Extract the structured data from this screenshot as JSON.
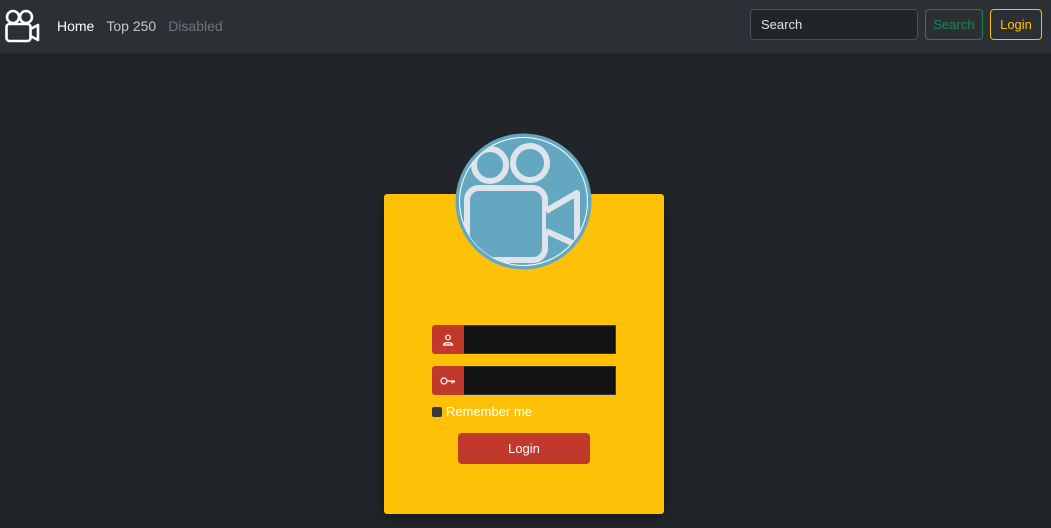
{
  "navbar": {
    "brand_icon": "video-camera-icon",
    "links": [
      {
        "label": "Home",
        "state": "active"
      },
      {
        "label": "Top 250",
        "state": "normal"
      },
      {
        "label": "Disabled",
        "state": "disabled"
      }
    ],
    "search": {
      "placeholder": "Search",
      "button_label": "Search"
    },
    "login_label": "Login"
  },
  "login_form": {
    "avatar_icon": "video-camera-icon",
    "username": {
      "icon": "user-icon",
      "value": ""
    },
    "password": {
      "icon": "key-icon",
      "value": ""
    },
    "remember_label": "Remember me",
    "remember_checked": false,
    "submit_label": "Login"
  },
  "colors": {
    "page_bg": "#212529",
    "navbar_bg": "#2b3035",
    "card_bg": "#ffc107",
    "accent_red": "#c0392b",
    "avatar_blue": "#64a7c1",
    "search_green": "#198754",
    "login_yellow": "#ffc107"
  }
}
